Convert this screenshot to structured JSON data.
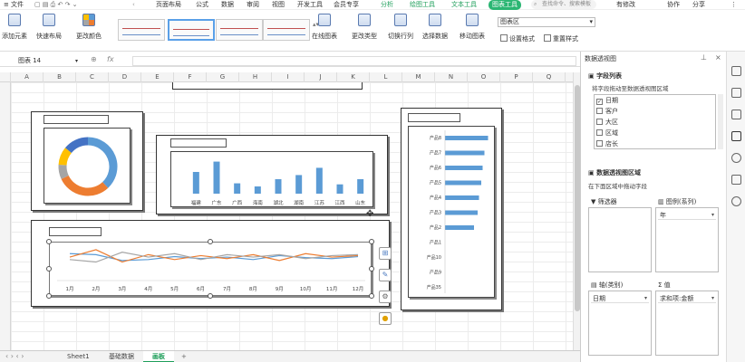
{
  "menu": {
    "file": "文件",
    "items": [
      "页面布局",
      "公式",
      "数据",
      "审阅",
      "视图",
      "开发工具",
      "会员专享"
    ],
    "context_tabs": [
      "分析",
      "绘图工具",
      "文本工具"
    ],
    "active_tab": "图表工具",
    "search_placeholder": "查找命令、搜索模板",
    "right_items": [
      "有修改",
      "协作",
      "分享"
    ]
  },
  "ribbon": {
    "buttons": [
      "添加元素",
      "快速布局",
      "更改颜色"
    ],
    "buttons2": [
      "在线图表",
      "更改类型",
      "切换行列",
      "选择数据",
      "移动图表"
    ],
    "select_value": "图表区",
    "small_buttons": [
      "设置格式",
      "重置样式"
    ]
  },
  "formula": {
    "namebox": "图表 14",
    "fx": "fx"
  },
  "columns": [
    "A",
    "B",
    "C",
    "D",
    "E",
    "F",
    "G",
    "H",
    "I",
    "J",
    "K",
    "L",
    "M",
    "N",
    "O",
    "P",
    "Q"
  ],
  "donut": {
    "segments": [
      {
        "value": 38,
        "color": "#5b9bd5"
      },
      {
        "value": 30,
        "color": "#ed7d31"
      },
      {
        "value": 8,
        "color": "#a5a5a5"
      },
      {
        "value": 10,
        "color": "#ffc000"
      },
      {
        "value": 14,
        "color": "#4472c4"
      }
    ]
  },
  "chart_data": [
    {
      "type": "bar",
      "categories": [
        "福建",
        "广东",
        "广西",
        "海南",
        "湖北",
        "湖南",
        "江苏",
        "江西",
        "山东"
      ],
      "values": [
        42,
        62,
        20,
        14,
        28,
        36,
        50,
        18,
        28
      ],
      "ylim": [
        0,
        70
      ],
      "color": "#5b9bd5"
    },
    {
      "type": "bar",
      "orientation": "horizontal",
      "categories": [
        "产品8",
        "产品7",
        "产品6",
        "产品5",
        "产品4",
        "产品3",
        "产品2",
        "产品1",
        "产品10",
        "产品9",
        "产品35"
      ],
      "values": [
        95,
        87,
        83,
        80,
        75,
        72,
        64,
        0,
        0,
        0,
        0
      ],
      "xlim": [
        0,
        100
      ],
      "color": "#5b9bd5"
    },
    {
      "type": "line",
      "categories": [
        "1月",
        "2月",
        "3月",
        "4月",
        "5月",
        "6月",
        "7月",
        "8月",
        "9月",
        "10月",
        "11月",
        "12月"
      ],
      "series": [
        {
          "values": [
            62,
            60,
            48,
            50,
            56,
            52,
            55,
            50,
            58,
            54,
            52,
            56
          ],
          "color": "#5b9bd5"
        },
        {
          "values": [
            55,
            70,
            45,
            60,
            50,
            58,
            52,
            60,
            48,
            62,
            55,
            58
          ],
          "color": "#ed7d31"
        },
        {
          "values": [
            50,
            45,
            65,
            55,
            62,
            50,
            60,
            55,
            60,
            52,
            58,
            60
          ],
          "color": "#a5a5a5"
        }
      ],
      "ylim": [
        0,
        100
      ]
    }
  ],
  "pane": {
    "title": "数据透视图",
    "field_list_title": "字段列表",
    "field_hint": "将字段拖动至数据透视图区域",
    "fields": [
      {
        "label": "日期",
        "checked": true
      },
      {
        "label": "客户",
        "checked": false
      },
      {
        "label": "大区",
        "checked": false
      },
      {
        "label": "区域",
        "checked": false
      },
      {
        "label": "店长",
        "checked": false
      }
    ],
    "areas_title": "数据透视图区域",
    "areas_hint": "在下面区域中拖动字段",
    "filter_label": "筛选器",
    "legend_label": "图例(系列)",
    "legend_value": "年",
    "axis_label": "轴(类别)",
    "axis_value": "日期",
    "values_label": "值",
    "values_value": "求和项:金额"
  },
  "sheets": {
    "tabs": [
      "Sheet1",
      "基础数据",
      "画板"
    ],
    "active": "画板",
    "add": "+"
  }
}
